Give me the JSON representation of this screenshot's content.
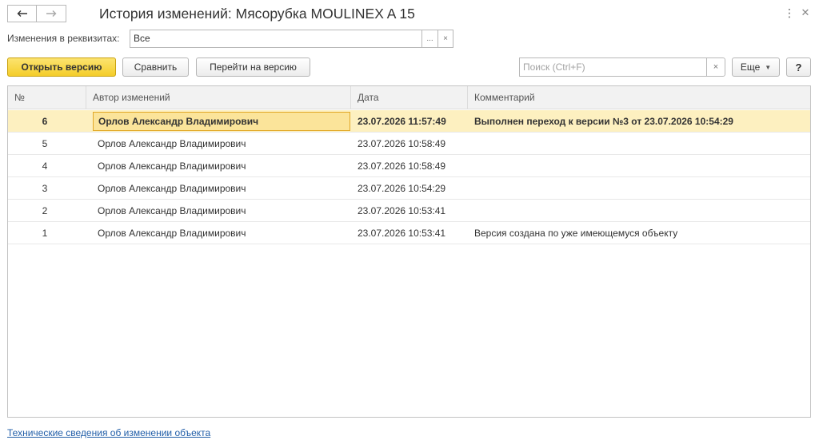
{
  "window": {
    "title": "История изменений: Мясорубка MOULINEX  A 15"
  },
  "filter": {
    "label": "Изменения в реквизитах:",
    "value": "Все",
    "select_glyph": "...",
    "clear_glyph": "×"
  },
  "toolbar": {
    "open_version_label": "Открыть версию",
    "compare_label": "Сравнить",
    "goto_version_label": "Перейти на версию",
    "search_placeholder": "Поиск (Ctrl+F)",
    "search_clear_glyph": "×",
    "more_label": "Еще",
    "help_label": "?"
  },
  "table": {
    "columns": {
      "num": "№",
      "author": "Автор изменений",
      "date": "Дата",
      "comment": "Комментарий"
    },
    "rows": [
      {
        "num": "6",
        "author": "Орлов Александр Владимирович",
        "date": "23.07.2026 11:57:49",
        "comment": "Выполнен переход к версии №3 от 23.07.2026 10:54:29"
      },
      {
        "num": "5",
        "author": "Орлов Александр Владимирович",
        "date": "23.07.2026 10:58:49",
        "comment": ""
      },
      {
        "num": "4",
        "author": "Орлов Александр Владимирович",
        "date": "23.07.2026 10:58:49",
        "comment": ""
      },
      {
        "num": "3",
        "author": "Орлов Александр Владимирович",
        "date": "23.07.2026 10:54:29",
        "comment": ""
      },
      {
        "num": "2",
        "author": "Орлов Александр Владимирович",
        "date": "23.07.2026 10:53:41",
        "comment": ""
      },
      {
        "num": "1",
        "author": "Орлов Александр Владимирович",
        "date": "23.07.2026 10:53:41",
        "comment": "Версия создана по уже имеющемуся объекту"
      }
    ]
  },
  "footer": {
    "tech_link": "Технические сведения об изменении объекта"
  },
  "icons": {
    "back": "arrow-left-icon",
    "forward": "arrow-right-icon",
    "more": "vertical-dots-icon",
    "close": "close-icon"
  },
  "colors": {
    "primary_button": "#f4cd2a",
    "selected_row": "#fdf0c0",
    "link": "#215ea8"
  }
}
